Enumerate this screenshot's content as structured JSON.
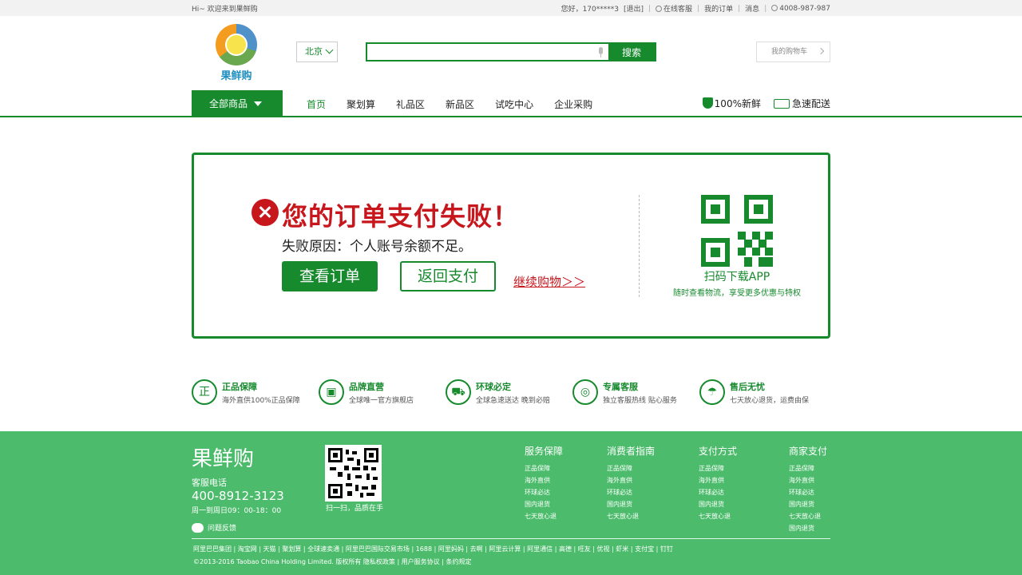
{
  "topbar": {
    "greeting": "Hi~ 欢迎来到果鲜购",
    "user": "您好，170*****3",
    "logout": "[退出]",
    "online_service": "在线客服",
    "my_orders": "我的订单",
    "messages": "消息",
    "phone": "4008-987-987"
  },
  "header": {
    "logo_text": "果鲜购",
    "city": "北京",
    "search_placeholder": "",
    "search_button": "搜索",
    "cart": "我的购物车"
  },
  "nav": {
    "all_categories": "全部商品",
    "links": [
      "首页",
      "聚划算",
      "礼品区",
      "新品区",
      "试吃中心",
      "企业采购"
    ],
    "active_index": 0,
    "badge_fresh": "100%新鲜",
    "badge_delivery": "急速配送"
  },
  "result": {
    "title": "您的订单支付失败！",
    "reason": "失败原因：个人账号余额不足。",
    "view_order": "查看订单",
    "return_pay": "返回支付",
    "continue_shopping": "继续购物＞＞",
    "qr_caption": "扫码下载APP",
    "qr_sub": "随时查看物流，享受更多优惠与特权"
  },
  "features": [
    {
      "icon": "正",
      "title": "正品保障",
      "sub": "海外直供100%正品保障"
    },
    {
      "icon": "bag-icon",
      "title": "品牌直营",
      "sub": "全球唯一官方旗舰店"
    },
    {
      "icon": "truck-icon",
      "title": "环球必定",
      "sub": "全球急速送达  晚到必赔"
    },
    {
      "icon": "headset-icon",
      "title": "专属客服",
      "sub": "独立客服热线  贴心服务"
    },
    {
      "icon": "umbrella-icon",
      "title": "售后无忧",
      "sub": "七天放心退货，运费由保"
    }
  ],
  "footer": {
    "brand": "果鲜购",
    "tel_label": "客服电话",
    "tel": "400-8912-3123",
    "hours": "周一到周日09：00-18：00",
    "feedback": "问题反馈",
    "qr_caption": "扫一扫，品质在手",
    "columns": [
      {
        "title": "服务保障",
        "items": [
          "正品保障",
          "海外直供",
          "环球必达",
          "国内退货",
          "七天放心退"
        ]
      },
      {
        "title": "消费者指南",
        "items": [
          "正品保障",
          "海外直供",
          "环球必达",
          "国内退货",
          "七天放心退"
        ]
      },
      {
        "title": "支付方式",
        "items": [
          "正品保障",
          "海外直供",
          "环球必达",
          "国内退货",
          "七天放心退"
        ]
      },
      {
        "title": "商家支付",
        "items": [
          "正品保障",
          "海外直供",
          "环球必达",
          "国内退货",
          "七天放心退",
          "国内退货"
        ]
      }
    ],
    "links": "阿里巴巴集团 | 淘宝网 | 天猫 | 聚划算 | 全球速卖通 | 阿里巴巴国际交易市场 | 1688 | 阿里妈妈 | 去啊 | 阿里云计算 | 阿里通信 | 高德 | 旺友 | 优视 | 虾米 | 支付宝 | 钉钉",
    "copyright": "©2013-2016 Taobao China Holding Limited. 版权所有 隐私权政策 | 用户服务协议 | 条约规定"
  }
}
